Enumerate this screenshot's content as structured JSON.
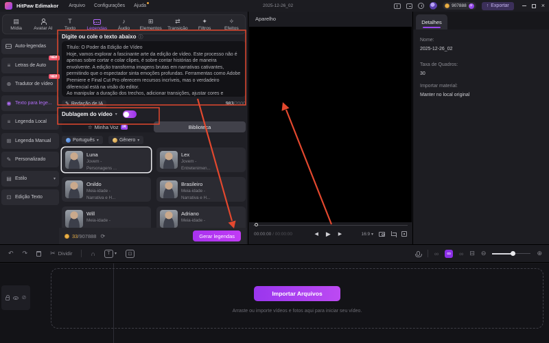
{
  "colors": {
    "accent": "#9b3df0",
    "annotation": "#e3482e",
    "badge_new": "#f2566f",
    "credit_gold": "#e8b04a"
  },
  "titlebar": {
    "app_name": "HitPaw Edimakor",
    "menus": [
      "Arquivo",
      "Configurações",
      "Ajuda"
    ],
    "doc_title": "2025-12-26_02",
    "credits": "907888",
    "export_label": "Exportar"
  },
  "ribbon_tabs": [
    {
      "label": "Mídia"
    },
    {
      "label": "Avatar AI"
    },
    {
      "label": "Texto"
    },
    {
      "label": "Legendas"
    },
    {
      "label": "Áudio"
    },
    {
      "label": "Elementos"
    },
    {
      "label": "Transição"
    },
    {
      "label": "Filtros"
    },
    {
      "label": "Efeitos"
    }
  ],
  "sidebar": {
    "items": [
      {
        "label": "Auto-legendas"
      },
      {
        "label": "Letras de Auto",
        "badge": "NEW"
      },
      {
        "label": "Tradutor de vídeo",
        "badge": "NEW"
      },
      {
        "label": "Texto para lege..."
      },
      {
        "label": "Legenda Local"
      },
      {
        "label": "Legenda Manual"
      },
      {
        "label": "Personalizado"
      },
      {
        "label": "Estilo"
      },
      {
        "label": "Edição Texto"
      }
    ]
  },
  "caption_panel": {
    "input_header": "Digite ou cole o texto abaixo",
    "input_text": "Título: O Poder da Edição de Vídeo\nHoje, vamos explorar a fascinante arte da edição de vídeo. Este processo não é apenas sobre cortar e colar clipes, é sobre contar histórias de maneira envolvente. A edição transforma imagens brutas em narrativas cativantes, permitindo que o espectador sinta emoções profundas. Ferramentas como Adobe Premiere e Final Cut Pro oferecem recursos incríveis, mas o verdadeiro diferencial está na visão do editor.\nAo manipular a duração dos trechos, adicionar transições, ajustar cores e incorporar trilhas sonoras, o editor se torna um artista, moldando a experiência do público. A",
    "ai_writer": "Redação de IA",
    "char_count": "983",
    "char_max": "/2000",
    "dubbing_label": "Dublagem do vídeo",
    "my_voice_tab": "Minha Voz",
    "ai_badge": "IA",
    "library_tab": "Biblioteca",
    "language_filter": "Português",
    "gender_filter": "Gênero",
    "voices": [
      {
        "name": "Luna",
        "desc1": "Jovem -",
        "desc2": "Personagens ..."
      },
      {
        "name": "Lex",
        "desc1": "Jovem -",
        "desc2": "Entretenimen..."
      },
      {
        "name": "Onildo",
        "desc1": "Meia-idade -",
        "desc2": "Narrativa e H..."
      },
      {
        "name": "Brasileiro",
        "desc1": "Meia-idade -",
        "desc2": "Narrativa e H..."
      },
      {
        "name": "Will",
        "desc1": "Meia-idade -",
        "desc2": ""
      },
      {
        "name": "Adriano",
        "desc1": "Meia-idade -",
        "desc2": ""
      }
    ],
    "cost": "33",
    "cost_total": "/907888",
    "generate_button": "Gerar legendas"
  },
  "preview": {
    "title": "Aparelho",
    "time_current": "00:00:00",
    "time_sep": " / ",
    "time_total": "00:00:00",
    "ratio": "16:9"
  },
  "details": {
    "tab": "Detalhes",
    "name_label": "Nome:",
    "name_value": "2025-12-26_02",
    "fps_label": "Taxa de Quadros:",
    "fps_value": "30",
    "import_label": "Importar material:",
    "import_value": "Manter no local original"
  },
  "timeline": {
    "split_label": "Dividir",
    "import_button": "Importar Arquivos",
    "drop_hint": "Arraste ou importe vídeos e fotos aqui para iniciar seu vídeo."
  },
  "icons": {
    "info": "ⓘ",
    "caret": "▾",
    "edit": "✎",
    "star": "☆",
    "refresh": "⟳",
    "media_tab": "▤",
    "text_tab": "T",
    "audio_tab": "♪",
    "elements_tab": "⊞",
    "transition_tab": "⇄",
    "filters_tab": "✦",
    "effects_tab": "✧",
    "s_lyrics": "≡",
    "s_translate": "⊕",
    "s_t2s": "◉",
    "s_local": "≡",
    "s_manual": "⊞",
    "s_custom": "✎",
    "s_style": "▤",
    "s_textedit": "⊡",
    "undo": "↶",
    "redo": "↷",
    "split": "✂",
    "magnet": "∩",
    "text_tool": "T",
    "link": "∞",
    "expand": "⊟",
    "zoom_in": "⊕",
    "zoom_out": "⊖",
    "mute": "⊘",
    "prev": "◀",
    "play": "▶",
    "next": "▶",
    "export_arrow": "↑",
    "plus": "+",
    "close": "×"
  }
}
